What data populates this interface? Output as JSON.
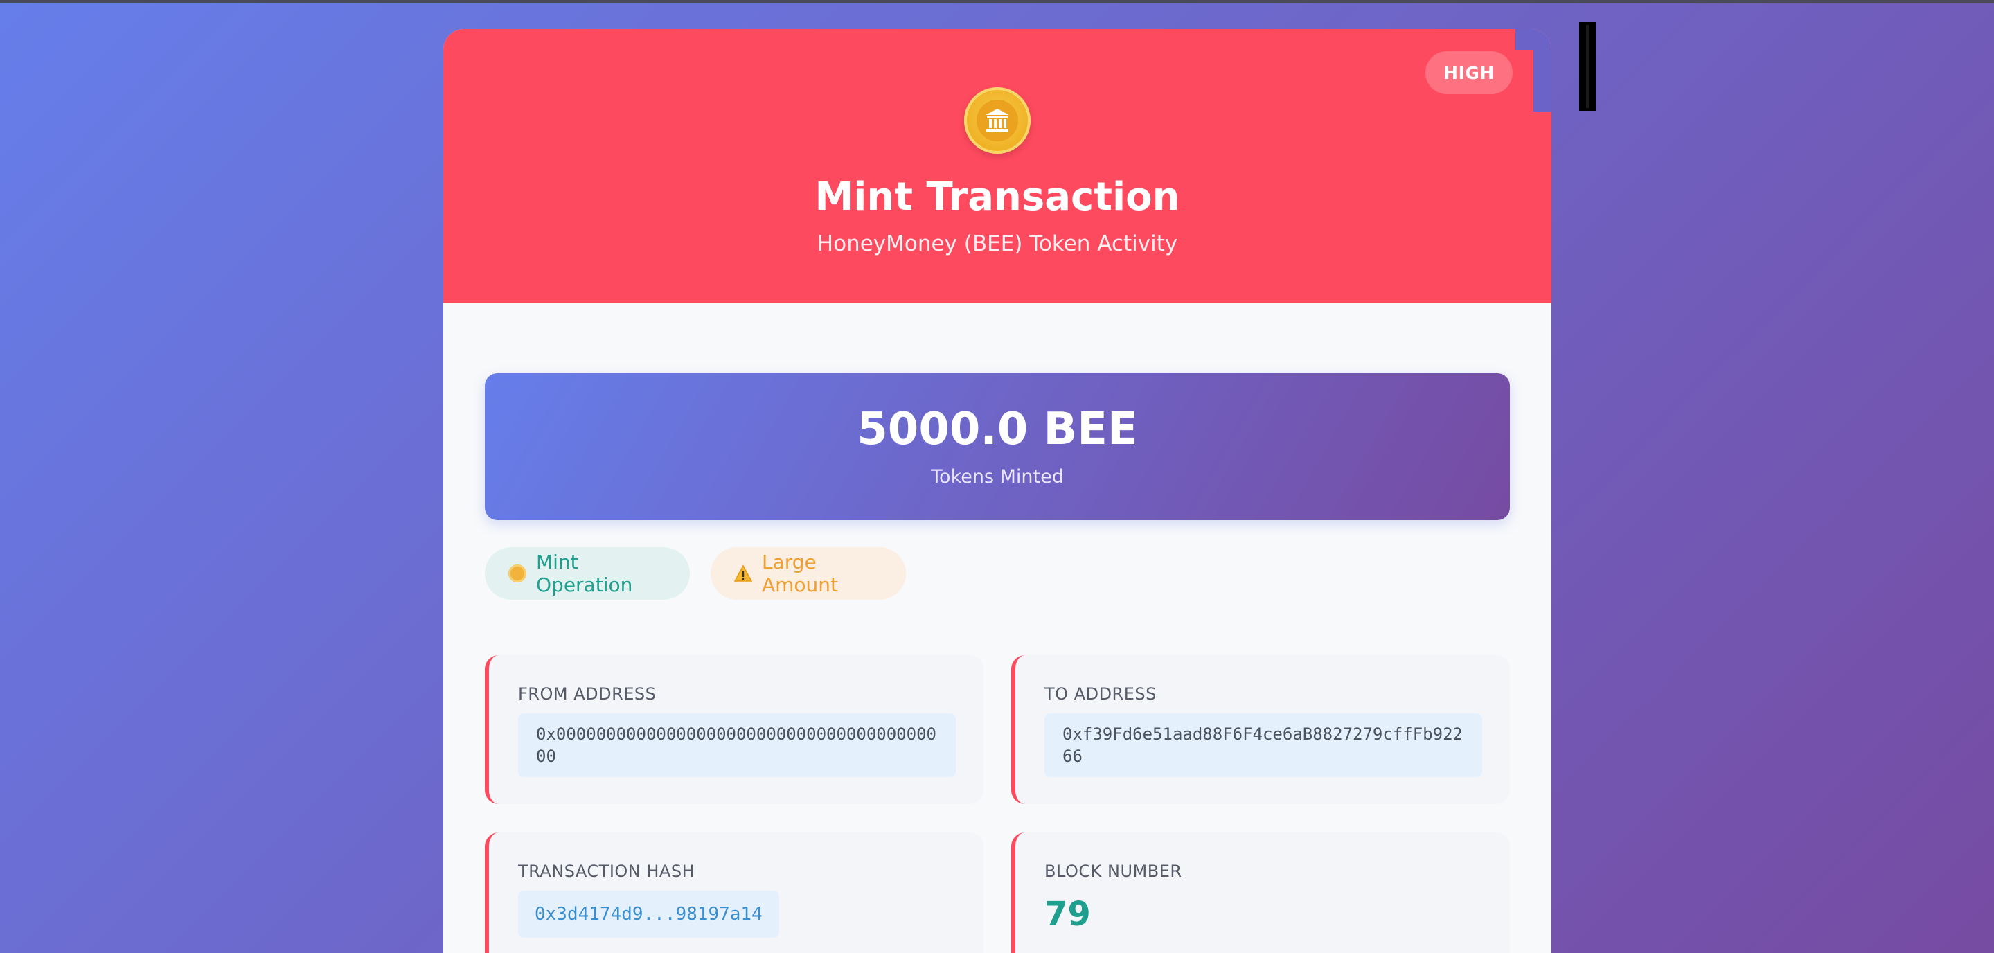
{
  "header": {
    "risk_badge": "HIGH",
    "title": "Mint Transaction",
    "subtitle": "HoneyMoney (BEE) Token Activity",
    "icon": "bank-coin-icon"
  },
  "amount": {
    "value": "5000.0 BEE",
    "label": "Tokens Minted"
  },
  "tags": [
    {
      "label": "Mint Operation",
      "icon": "coin-icon"
    },
    {
      "label": "Large Amount",
      "icon": "warning-icon"
    }
  ],
  "fields": {
    "from": {
      "label": "FROM ADDRESS",
      "value": "0x0000000000000000000000000000000000000000"
    },
    "to": {
      "label": "TO ADDRESS",
      "value": "0xf39Fd6e51aad88F6F4ce6aB8827279cffFb92266"
    },
    "hash": {
      "label": "TRANSACTION HASH",
      "value": "0x3d4174d9...98197a14"
    },
    "block": {
      "label": "BLOCK NUMBER",
      "value": "79"
    }
  },
  "colors": {
    "background_gradient": [
      "#667eea",
      "#764ba2"
    ],
    "header": "#fe4a5e",
    "accent_teal": "#1fa08e",
    "warning_orange": "#f0a030"
  }
}
